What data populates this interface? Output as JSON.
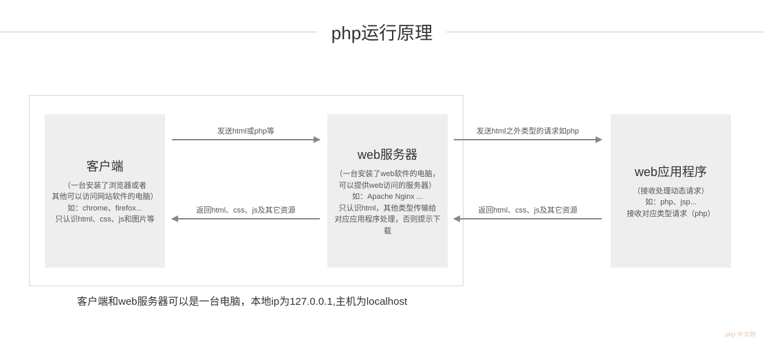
{
  "title": "php运行原理",
  "boxes": {
    "client": {
      "title": "客户端",
      "lines": [
        "（一台安装了浏览器或者",
        "其他可以访问网站软件的电脑）",
        "如：chrome、firefox...",
        "只认识html、css、js和图片等"
      ]
    },
    "server": {
      "title": "web服务器",
      "lines": [
        "（一台安装了web软件的电脑，",
        "可以提供web访问的服务器）",
        "如：Apache Nginx ...",
        "只认识html，其他类型传输给",
        "对应应用程序处理，否则提示下载"
      ]
    },
    "app": {
      "title": "web应用程序",
      "lines": [
        "（接收处理动态请求）",
        "如：php、jsp...",
        "接收对应类型请求（php）"
      ]
    }
  },
  "arrows": {
    "a1": "发送html或php等",
    "a2": "返回html、css、js及其它资源",
    "a3": "发送html之外类型的请求如php",
    "a4": "返回html、css、js及其它资源"
  },
  "footnote": "客户端和web服务器可以是一台电脑，本地ip为127.0.0.1,主机为localhost",
  "watermark": "php 中文网"
}
